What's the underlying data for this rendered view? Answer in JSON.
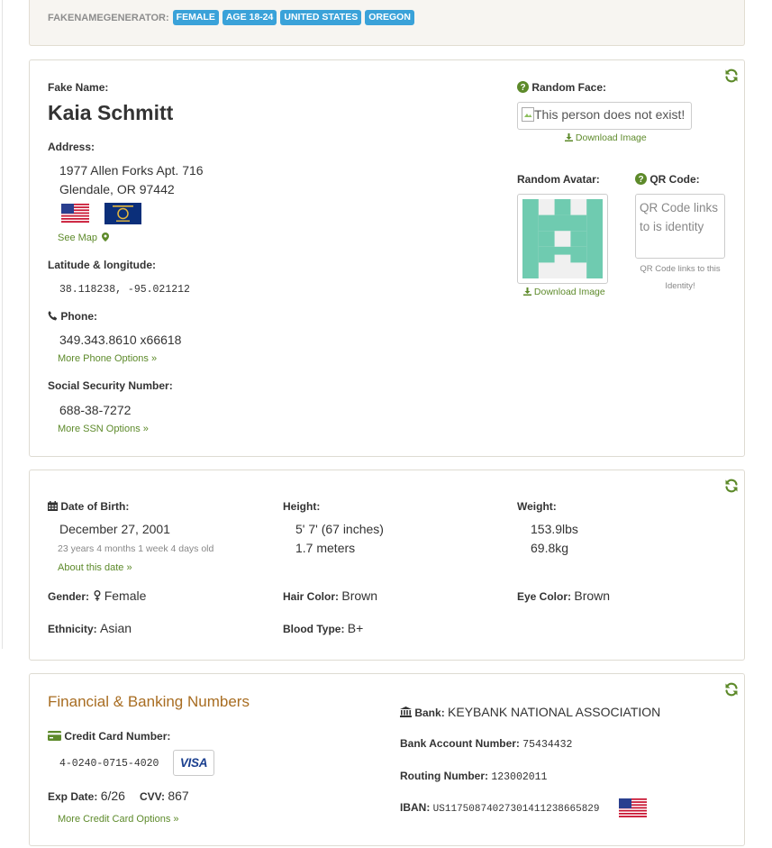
{
  "breadcrumb": {
    "label": "FAKENAMEGENERATOR:",
    "tags": [
      "FEMALE",
      "AGE 18-24",
      "UNITED STATES",
      "OREGON"
    ]
  },
  "identity": {
    "fake_name_label": "Fake Name:",
    "name": "Kaia Schmitt",
    "address_label": "Address:",
    "address_line1": "1977 Allen Forks Apt. 716",
    "address_line2": "Glendale, OR 97442",
    "see_map": "See Map",
    "latlng_label": "Latitude & longitude:",
    "latlng": "38.118238, -95.021212",
    "phone_label": "Phone:",
    "phone": "349.343.8610 x66618",
    "more_phone": "More Phone Options »",
    "ssn_label": "Social Security Number:",
    "ssn": "688-38-7272",
    "more_ssn": "More SSN Options »",
    "random_face_label": "Random Face:",
    "face_alt": "This person does not exist!",
    "download_image": "Download Image",
    "random_avatar_label": "Random Avatar:",
    "qr_label": "QR Code:",
    "qr_alt": "QR Code links to is identity",
    "qr_caption": "QR Code links to this Identity!"
  },
  "physical": {
    "dob_label": "Date of Birth:",
    "dob": "December 27, 2001",
    "age": "23 years 4 months 1 week 4 days old",
    "about_date": "About this date »",
    "height_label": "Height:",
    "height_imperial": "5' 7' (67 inches)",
    "height_metric": "1.7 meters",
    "weight_label": "Weight:",
    "weight_lbs": "153.9lbs",
    "weight_kg": "69.8kg",
    "gender_label": "Gender:",
    "gender": "Female",
    "hair_label": "Hair Color:",
    "hair": "Brown",
    "eye_label": "Eye Color:",
    "eye": "Brown",
    "ethnicity_label": "Ethnicity:",
    "ethnicity": "Asian",
    "blood_label": "Blood Type:",
    "blood": "B+"
  },
  "financial": {
    "title": "Financial & Banking Numbers",
    "cc_label": "Credit Card Number:",
    "cc_number": "4-0240-0715-4020",
    "card_brand": "VISA",
    "exp_label": "Exp Date:",
    "exp": "6/26",
    "cvv_label": "CVV:",
    "cvv": "867",
    "more_cc": "More Credit Card Options »",
    "bank_label": "Bank:",
    "bank": "KEYBANK NATIONAL ASSOCIATION",
    "account_label": "Bank Account Number:",
    "account": "75434432",
    "routing_label": "Routing Number:",
    "routing": "123002011",
    "iban_label": "IBAN:",
    "iban": "US11750874027301411238665829"
  },
  "colors": {
    "accent_green": "#5d8a2a",
    "badge_blue": "#3aa2d9",
    "title_brown": "#a86d22",
    "avatar_teal": "#6fcbb0"
  },
  "icons": [
    "refresh-icon",
    "question-icon",
    "download-icon",
    "map-marker-icon",
    "phone-icon",
    "calendar-icon",
    "female-icon",
    "credit-card-icon",
    "bank-icon",
    "us-flag-icon",
    "oregon-flag-icon"
  ]
}
